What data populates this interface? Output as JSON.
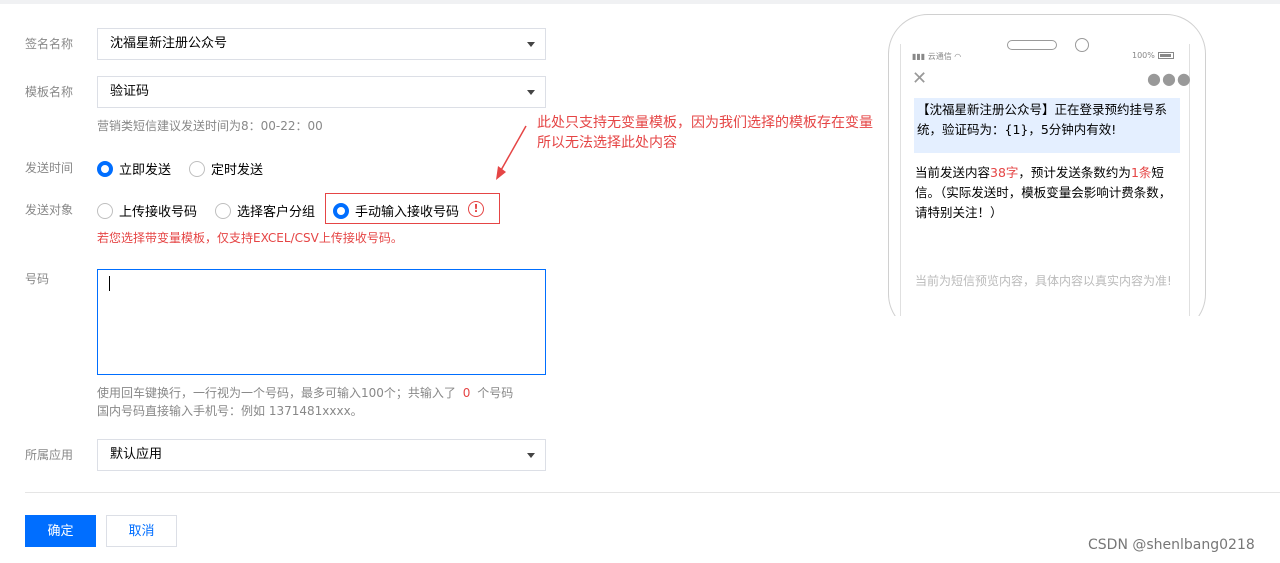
{
  "form": {
    "signature": {
      "label": "签名名称",
      "value": "沈福星新注册公众号"
    },
    "template": {
      "label": "模板名称",
      "value": "验证码",
      "hint": "营销类短信建议发送时间为8：00-22：00"
    },
    "send_time": {
      "label": "发送时间",
      "options": [
        "立即发送",
        "定时发送"
      ],
      "selected": "立即发送"
    },
    "send_target": {
      "label": "发送对象",
      "options": [
        "上传接收号码",
        "选择客户分组",
        "手动输入接收号码"
      ],
      "selected": "手动输入接收号码",
      "warning_icon": "!",
      "error": "若您选择带变量模板，仅支持EXCEL/CSV上传接收号码。"
    },
    "numbers": {
      "label": "号码",
      "value": "",
      "hint_prefix": "使用回车键换行，一行视为一个号码，最多可输入100个；共输入了",
      "count": "0",
      "hint_suffix": "个号码",
      "hint2": "国内号码直接输入手机号：例如 1371481xxxx。"
    },
    "app": {
      "label": "所属应用",
      "value": "默认应用"
    }
  },
  "annotation": {
    "line1": "此处只支持无变量模板，因为我们选择的模板存在变量",
    "line2": "所以无法选择此处内容"
  },
  "buttons": {
    "confirm": "确定",
    "cancel": "取消"
  },
  "preview": {
    "carrier": "云通信",
    "battery": "100%",
    "message": "【沈福星新注册公众号】正在登录预约挂号系统，验证码为：{1}，5分钟内有效!",
    "count_prefix": "当前发送内容",
    "count_chars": "38字",
    "count_mid": "，预计发送条数约为",
    "count_msgs": "1条",
    "count_suffix": "短信。（实际发送时，模板变量会影响计费条数，请特别关注！）",
    "note": "当前为短信预览内容，具体内容以真实内容为准!"
  },
  "watermark": "CSDN @shenlbang0218",
  "colors": {
    "primary": "#006eff",
    "danger": "#e54545"
  }
}
